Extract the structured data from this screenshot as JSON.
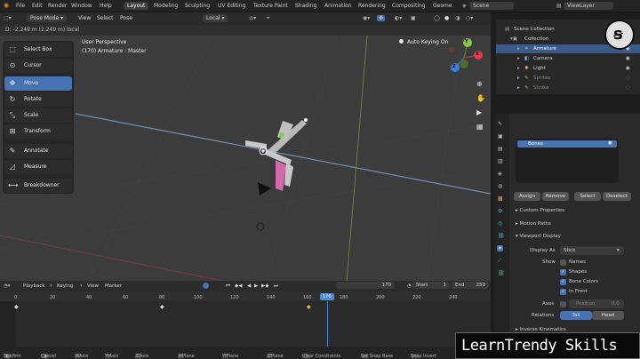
{
  "topbar": {
    "menus": [
      "File",
      "Edit",
      "Render",
      "Window",
      "Help"
    ],
    "workspaces": [
      "Layout",
      "Modeling",
      "Sculpting",
      "UV Editing",
      "Texture Paint",
      "Shading",
      "Animation",
      "Rendering",
      "Compositing",
      "Geome"
    ],
    "active_workspace": "Layout",
    "scene": "Scene",
    "view_layer": "ViewLayer"
  },
  "header": {
    "mode": "Pose Mode",
    "view": "View",
    "select": "Select",
    "pose": "Pose",
    "orientation": "Local"
  },
  "statusline": "D: -2.249 m (2.249 m) local",
  "viewport": {
    "perspective": "User Perspective",
    "object_info": "(170) Armature : Master",
    "auto_keying": "Auto Keying On",
    "gizmo": {
      "x": "X",
      "y": "Y",
      "z": "Z"
    }
  },
  "tools": [
    {
      "label": "Select Box",
      "icon": "select-box-icon"
    },
    {
      "label": "Cursor",
      "icon": "cursor-icon"
    },
    {
      "label": "Move",
      "icon": "move-icon",
      "active": true
    },
    {
      "label": "Rotate",
      "icon": "rotate-icon"
    },
    {
      "label": "Scale",
      "icon": "scale-icon"
    },
    {
      "label": "Transform",
      "icon": "transform-icon"
    },
    {
      "label": "Annotate",
      "icon": "annotate-icon"
    },
    {
      "label": "Measure",
      "icon": "measure-icon"
    },
    {
      "label": "Breakdowner",
      "icon": "breakdowner-icon"
    }
  ],
  "outliner": {
    "scene_collection": "Scene Collection",
    "collection": "Collection",
    "items": [
      "Armature",
      "Camera",
      "Light",
      "Sprites",
      "Stroke"
    ]
  },
  "properties": {
    "bone_collection": "Bones",
    "buttons": [
      "Assign",
      "Remove",
      "Select",
      "Deselect"
    ],
    "sections": [
      "Custom Properties",
      "Motion Paths",
      "Viewport Display"
    ],
    "display_as_label": "Display As",
    "display_as_value": "Stick",
    "show_label": "Show",
    "show_options": [
      {
        "label": "Names",
        "checked": false
      },
      {
        "label": "Shapes",
        "checked": true
      },
      {
        "label": "Bone Colors",
        "checked": true
      },
      {
        "label": "In Front",
        "checked": true
      }
    ],
    "axes_label": "Axes",
    "position_label": "Position",
    "position_value": "0.0",
    "relations_label": "Relations",
    "relations_options": [
      "Tail",
      "Head"
    ],
    "inverse_kinematics": "Inverse Kinematics"
  },
  "timeline": {
    "playback": "Playback",
    "keying": "Keying",
    "view": "View",
    "marker": "Marker",
    "current_frame": "170",
    "start_label": "Start",
    "start": "1",
    "end_label": "End",
    "end": "250",
    "ticks": [
      "0",
      "20",
      "40",
      "60",
      "80",
      "100",
      "120",
      "140",
      "160",
      "170",
      "180",
      "200",
      "220",
      "240"
    ]
  },
  "statusbar": [
    {
      "label": "Confirm"
    },
    {
      "label": "Cancel"
    },
    {
      "key": "X",
      "label": "X Axis"
    },
    {
      "key": "Y",
      "label": "Y Axis"
    },
    {
      "key": "Z",
      "label": "Z Axis"
    },
    {
      "key": "X",
      "label": "X Plane"
    },
    {
      "key": "Y",
      "label": "Y Plane"
    },
    {
      "key": "Z",
      "label": "Z Plane"
    },
    {
      "label": "Clear Constraints"
    },
    {
      "label": "Set Snap Base"
    },
    {
      "label": "Snap Invert"
    }
  ],
  "watermark": "LearnTrendy Skills",
  "colors": {
    "accent": "#4772b3",
    "x_axis": "#e2394f",
    "y_axis": "#8bc34a",
    "z_axis": "#3f7fe0",
    "playhead": "#4f8ad8",
    "bone": "#c8c8c8",
    "bone_pink": "#e06ab1"
  }
}
